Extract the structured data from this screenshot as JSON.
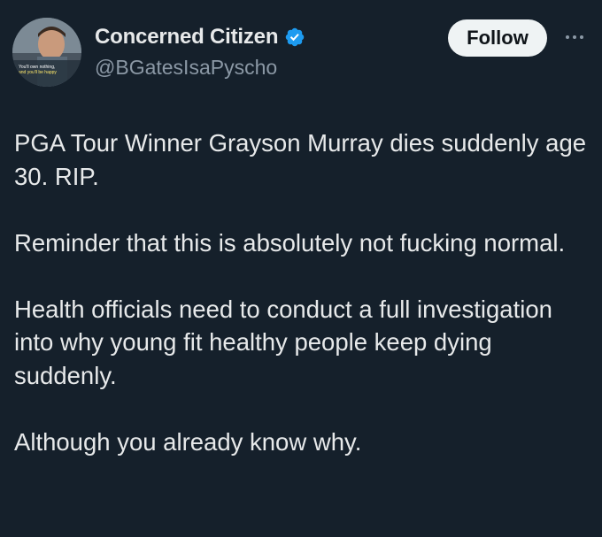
{
  "tweet": {
    "author": {
      "display_name": "Concerned Citizen",
      "handle": "@BGatesIsaPyscho",
      "verified": true,
      "verified_color": "#1d9bf0",
      "avatar_text": [
        "You'll own nothing,",
        "and you'll be happy"
      ]
    },
    "follow_label": "Follow",
    "more_icon": "more-horizontal-icon",
    "paragraphs": [
      "PGA Tour Winner Grayson Murray dies suddenly age 30.  RIP.",
      "Reminder that this is absolutely not fucking normal.",
      "Health officials need to conduct a full investigation into why young fit healthy people keep dying suddenly.",
      "Although you already know why."
    ]
  },
  "colors": {
    "background": "#15202b",
    "text": "#e7e9ea",
    "secondary_text": "#8b98a5",
    "follow_bg": "#eff3f4",
    "follow_text": "#0f1419"
  }
}
